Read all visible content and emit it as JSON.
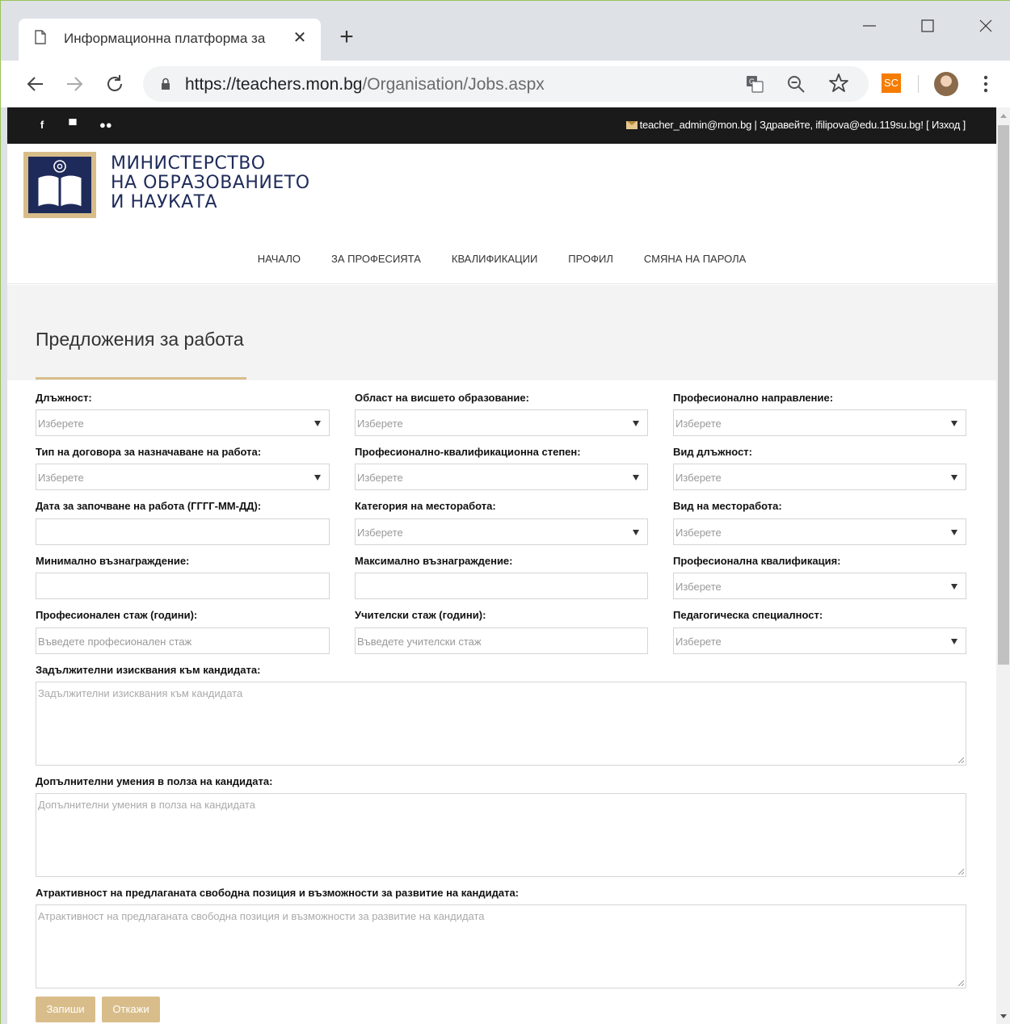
{
  "browser": {
    "tab_title": "Информационна платформа за",
    "url_main": "https://teachers.mon.bg",
    "url_path": "/Organisation/Jobs.aspx",
    "extension_label": "SC"
  },
  "topbar": {
    "user_text": "teacher_admin@mon.bg | Здравейте, ifilipova@edu.119su.bg! [ Изход ]",
    "social": [
      "f",
      "▀",
      "●●"
    ]
  },
  "header": {
    "logo_line1": "МИНИСТЕРСТВО",
    "logo_line2": "НА ОБРАЗОВАНИЕТО",
    "logo_line3": "И НАУКАТА",
    "nav": [
      "НАЧАЛО",
      "ЗА ПРОФЕСИЯТА",
      "КВАЛИФИКАЦИИ",
      "ПРОФИЛ",
      "СМЯНА НА ПАРОЛА"
    ]
  },
  "page": {
    "title": "Предложения за работа"
  },
  "form": {
    "select_placeholder": "Изберете",
    "position": "Длъжност:",
    "higher_ed_area": "Област на висшето образование:",
    "prof_direction": "Професионално направление:",
    "contract_type": "Тип на договора за назначаване на работа:",
    "qual_degree": "Професионално-квалификационна степен:",
    "position_type": "Вид длъжност:",
    "start_date": "Дата за започване на работа (ГГГГ-ММ-ДД):",
    "workplace_category": "Категория на месторабота:",
    "workplace_type": "Вид на месторабота:",
    "min_salary": "Минимално възнаграждение:",
    "max_salary": "Максимално възнаграждение:",
    "prof_qualification": "Професионална квалификация:",
    "prof_experience": "Професионален стаж (години):",
    "prof_experience_ph": "Въведете професионален стаж",
    "teach_experience": "Учителски стаж (години):",
    "teach_experience_ph": "Въведете учителски стаж",
    "ped_specialty": "Педагогическа специалност:",
    "mandatory_req": "Задължителни изисквания към кандидата:",
    "mandatory_req_ph": "Задължителни изисквания към кандидата",
    "additional_skills": "Допълнителни умения в полза на кандидата:",
    "additional_skills_ph": "Допълнителни умения в полза на кандидата",
    "attractiveness": "Атрактивност на предлаганата свободна позиция и възможности за развитие на кандидата:",
    "attractiveness_ph": "Атрактивност на предлаганата свободна позиция и възможности за развитие на кандидата",
    "save_label": "Запиши",
    "cancel_label": "Откажи"
  },
  "colors": {
    "accent": "#d8bd8a",
    "topbar_bg": "#1a1a1a",
    "brand_blue": "#1e2b5a"
  }
}
